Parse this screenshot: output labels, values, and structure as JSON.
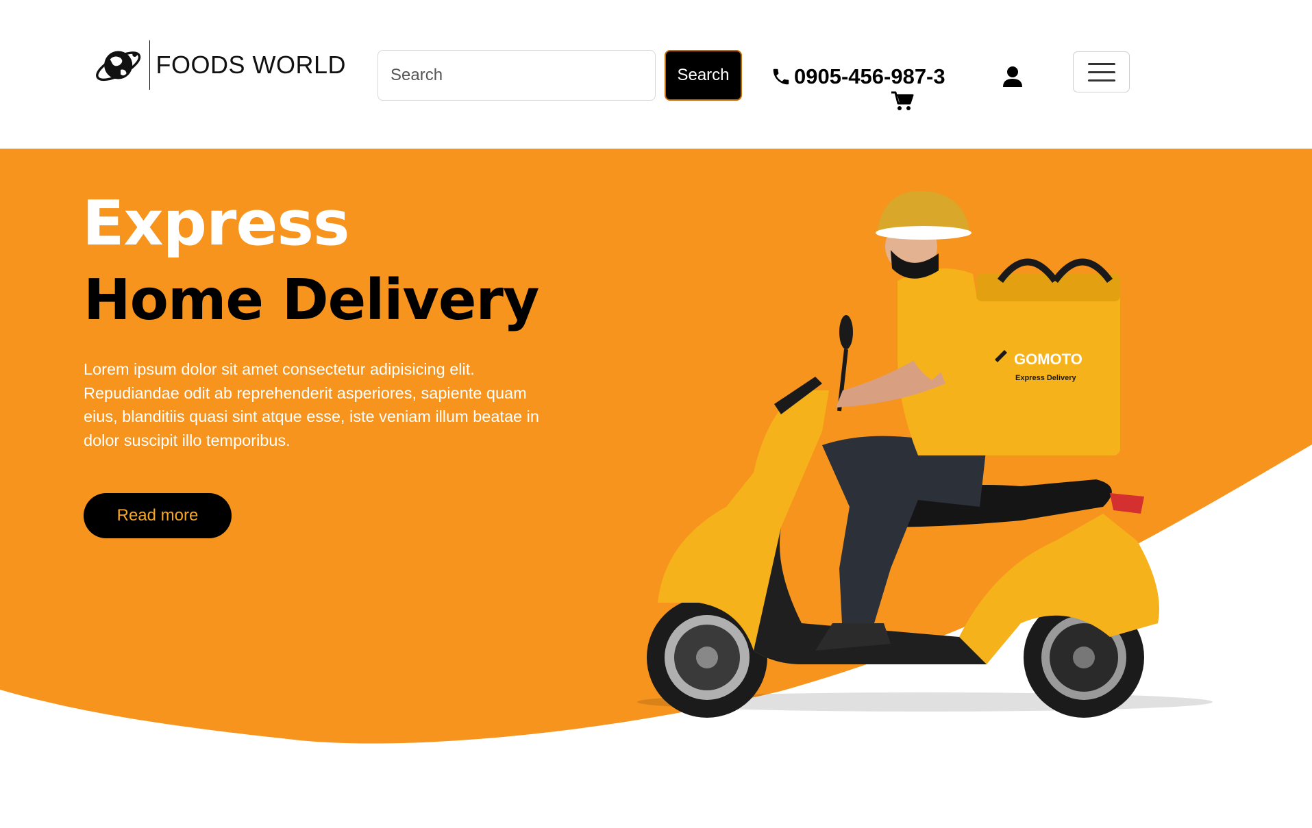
{
  "header": {
    "brand": "FOODS WORLD",
    "search": {
      "placeholder": "Search",
      "value": "",
      "button_label": "Search"
    },
    "phone": "0905-456-987-3",
    "icons": [
      "globe-logo-icon",
      "phone-icon",
      "cart-icon",
      "user-icon",
      "hamburger-menu-icon"
    ]
  },
  "hero": {
    "title_line_1": "Express",
    "title_line_2": "Home Delivery",
    "description": "Lorem ipsum dolor sit amet consectetur adipisicing elit. Repudiandae odit ab reprehenderit asperiores, sapiente quam eius, blanditiis quasi sint atque esse, iste veniam illum beatae in dolor suscipit illo temporibus.",
    "cta_label": "Read more",
    "image": {
      "bag_brand": "GOMOTO",
      "bag_tagline": "Express Delivery"
    }
  },
  "colors": {
    "hero_background": "#f7941d",
    "accent_yellow": "#f8b624",
    "button_dark": "#000000",
    "cta_text": "#f6a623"
  }
}
